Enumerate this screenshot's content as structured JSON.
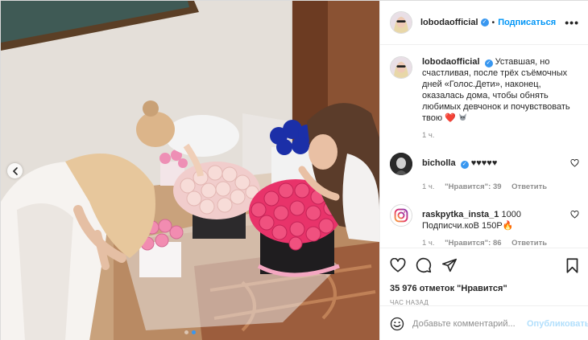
{
  "post": {
    "author": "lobodaofficial",
    "follow_label": "Подписаться",
    "more_label": "•••",
    "caption_text": "Уставшая, но счастливая, после трёх съёмочных дней «Голос.Дети», наконец, оказалась дома, чтобы обнять любимых девчонок и почувствовать твою",
    "caption_emoji": "❤️",
    "caption_time": "1 ч.",
    "likes": "35 976 отметок \"Нравится\"",
    "posted_ago": "ЧАС НАЗАД",
    "carousel": {
      "dots": 2,
      "active": 1
    }
  },
  "comments": [
    {
      "user": "bicholla",
      "verified": true,
      "text": "♥♥♥♥♥",
      "time": "1 ч.",
      "likes": "\"Нравится\": 39",
      "reply_label": "Ответить"
    },
    {
      "user": "raskpytka_insta_1",
      "verified": false,
      "text": "1000 Подписчи.коВ 150Р🔥",
      "time": "1 ч.",
      "likes": "\"Нравится\": 86",
      "reply_label": "Ответить"
    }
  ],
  "composer": {
    "placeholder": "Добавьте комментарий...",
    "publish_label": "Опубликовать"
  },
  "icons": {
    "verified": "verified-badge-icon",
    "like": "heart-icon",
    "comment": "comment-icon",
    "share": "share-icon",
    "save": "bookmark-icon",
    "emoji": "emoji-icon",
    "prev": "chevron-left-icon"
  },
  "colors": {
    "link_blue": "#0095f6",
    "verified_blue": "#3897f0",
    "muted": "#8e8e8e",
    "heart_red": "#d21f2e"
  }
}
